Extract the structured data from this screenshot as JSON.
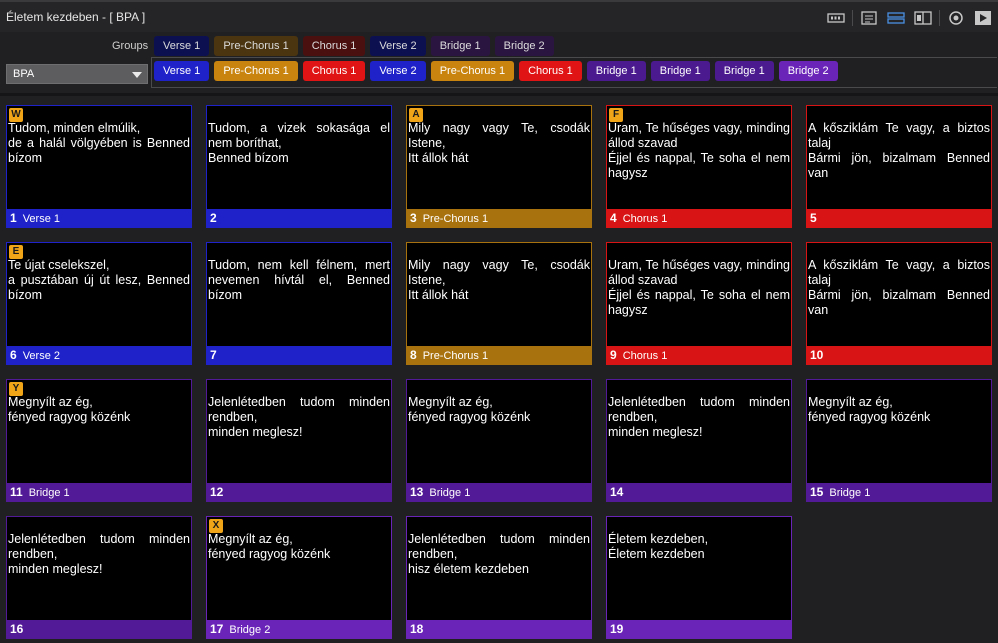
{
  "window": {
    "title": "Életem kezdeben - [ BPA ]"
  },
  "toolbar_icons": [
    "record-icon",
    "notes-icon",
    "sync-icon",
    "layout-icon",
    "target-icon",
    "play-icon"
  ],
  "groups_label": "Groups",
  "arrangement": {
    "selected": "BPA"
  },
  "colors": {
    "verse": "#1e22c8",
    "prechorus": "#a8720e",
    "chorus": "#d81414",
    "bridge1": "#521a96",
    "bridge2": "#6a24b8",
    "verse_dim": "#0c1050",
    "prechorus_dim": "#4a3510",
    "chorus_dim": "#4a1010",
    "bridge_dim": "#2a1440"
  },
  "groups": [
    {
      "label": "Verse 1",
      "color": "#0c1050"
    },
    {
      "label": "Pre-Chorus 1",
      "color": "#4a3510"
    },
    {
      "label": "Chorus 1",
      "color": "#4a1010"
    },
    {
      "label": "Verse 2",
      "color": "#0c1050"
    },
    {
      "label": "Bridge 1",
      "color": "#2a1440"
    },
    {
      "label": "Bridge 2",
      "color": "#2a1440"
    }
  ],
  "arrangement_items": [
    {
      "label": "Verse 1",
      "color": "#1e22c8"
    },
    {
      "label": "Pre-Chorus 1",
      "color": "#c8840e"
    },
    {
      "label": "Chorus 1",
      "color": "#e01414"
    },
    {
      "label": "Verse 2",
      "color": "#1e22c8"
    },
    {
      "label": "Pre-Chorus 1",
      "color": "#c8840e"
    },
    {
      "label": "Chorus 1",
      "color": "#e01414"
    },
    {
      "label": "Bridge 1",
      "color": "#4a1a8e"
    },
    {
      "label": "Bridge 1",
      "color": "#4a1a8e"
    },
    {
      "label": "Bridge 1",
      "color": "#4a1a8e"
    },
    {
      "label": "Bridge 2",
      "color": "#6a24b8"
    }
  ],
  "slides": [
    {
      "num": "1",
      "group": "Verse 1",
      "badge": "W",
      "color": "#1e22c8",
      "text": "Tudom, minden elmúlik,\nde a halál völgyében is Benned bízom"
    },
    {
      "num": "2",
      "group": "",
      "badge": "",
      "color": "#1e22c8",
      "text": "Tudom, a vizek sokasága el nem boríthat,\nBenned bízom"
    },
    {
      "num": "3",
      "group": "Pre-Chorus 1",
      "badge": "A",
      "color": "#a8720e",
      "text": "Mily nagy vagy Te, csodák Istene,\nItt állok hát"
    },
    {
      "num": "4",
      "group": "Chorus 1",
      "badge": "F",
      "color": "#d81414",
      "text": "Uram, Te hűséges vagy, minding állod szavad\nÉjjel és nappal, Te soha el nem hagysz"
    },
    {
      "num": "5",
      "group": "",
      "badge": "",
      "color": "#d81414",
      "text": "A kősziklám Te vagy, a biztos talaj\nBármi jön, bizalmam Benned van"
    },
    {
      "num": "6",
      "group": "Verse 2",
      "badge": "E",
      "color": "#1e22c8",
      "text": "Te újat cselekszel,\na pusztában új út lesz, Benned bízom"
    },
    {
      "num": "7",
      "group": "",
      "badge": "",
      "color": "#1e22c8",
      "text": "Tudom, nem kell félnem, mert nevemen hívtál el, Benned bízom"
    },
    {
      "num": "8",
      "group": "Pre-Chorus 1",
      "badge": "",
      "color": "#a8720e",
      "text": "Mily nagy vagy Te, csodák Istene,\nItt állok hát"
    },
    {
      "num": "9",
      "group": "Chorus 1",
      "badge": "",
      "color": "#d81414",
      "text": "Uram, Te hűséges vagy, minding állod szavad\nÉjjel és nappal, Te soha el nem hagysz"
    },
    {
      "num": "10",
      "group": "",
      "badge": "",
      "color": "#d81414",
      "text": "A kősziklám Te vagy, a biztos talaj\nBármi jön, bizalmam Benned van"
    },
    {
      "num": "11",
      "group": "Bridge 1",
      "badge": "Y",
      "color": "#521a96",
      "text": "Megnyílt az ég,\nfényed ragyog közénk"
    },
    {
      "num": "12",
      "group": "",
      "badge": "",
      "color": "#521a96",
      "text": "Jelenlétedben tudom minden rendben,\nminden meglesz!"
    },
    {
      "num": "13",
      "group": "Bridge 1",
      "badge": "",
      "color": "#521a96",
      "text": "Megnyílt az ég,\nfényed ragyog közénk"
    },
    {
      "num": "14",
      "group": "",
      "badge": "",
      "color": "#521a96",
      "text": "Jelenlétedben tudom minden rendben,\nminden meglesz!"
    },
    {
      "num": "15",
      "group": "Bridge 1",
      "badge": "",
      "color": "#521a96",
      "text": "Megnyílt az ég,\nfényed ragyog közénk"
    },
    {
      "num": "16",
      "group": "",
      "badge": "",
      "color": "#521a96",
      "text": "Jelenlétedben tudom minden rendben,\nminden meglesz!"
    },
    {
      "num": "17",
      "group": "Bridge 2",
      "badge": "X",
      "color": "#6a24b8",
      "text": "Megnyílt az ég,\nfényed ragyog közénk"
    },
    {
      "num": "18",
      "group": "",
      "badge": "",
      "color": "#6a24b8",
      "text": "Jelenlétedben tudom minden rendben,\nhisz életem kezdeben"
    },
    {
      "num": "19",
      "group": "",
      "badge": "",
      "color": "#6a24b8",
      "text": "Életem kezdeben,\nÉletem kezdeben"
    }
  ]
}
